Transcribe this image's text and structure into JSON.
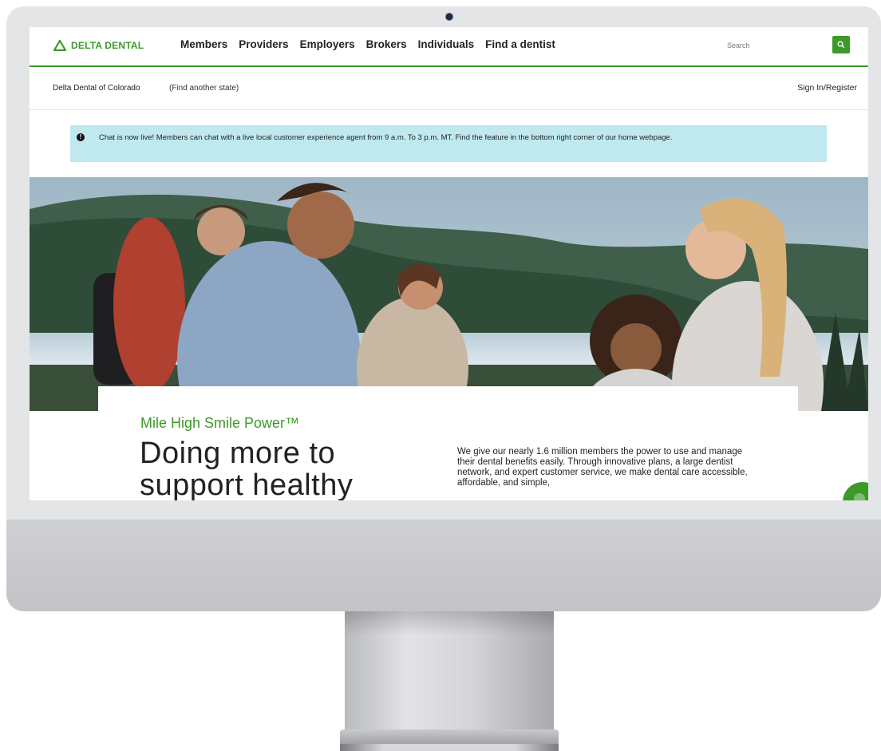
{
  "brand": {
    "name": "DELTA DENTAL",
    "color": "#3b9a28"
  },
  "nav": {
    "items": [
      {
        "label": "Members"
      },
      {
        "label": "Providers"
      },
      {
        "label": "Employers"
      },
      {
        "label": "Brokers"
      },
      {
        "label": "Individuals"
      },
      {
        "label": "Find a dentist"
      }
    ],
    "search": {
      "placeholder": "Search",
      "icon": "search-icon"
    }
  },
  "subbar": {
    "state": "Delta Dental of Colorado",
    "find_state": "(Find another state)",
    "sign_in": "Sign In/Register"
  },
  "alert": {
    "icon": "info-icon",
    "text": "Chat is now live! Members can chat with a live local customer experience agent from 9 a.m. To 3 p.m. MT. Find the feature in the bottom right corner of our home webpage.",
    "background": "#bfe9ee"
  },
  "hero": {
    "image": "group-of-friends-outdoors-photo"
  },
  "card": {
    "eyebrow": "Mile High Smile Power™",
    "headline": "Doing more to support healthy",
    "body": "We give our nearly 1.6 million members the power to use and manage their dental benefits easily. Through innovative plans, a large dentist network, and expert customer service, we make dental care accessible, affordable, and simple,"
  },
  "chat": {
    "icon": "chat-icon"
  }
}
